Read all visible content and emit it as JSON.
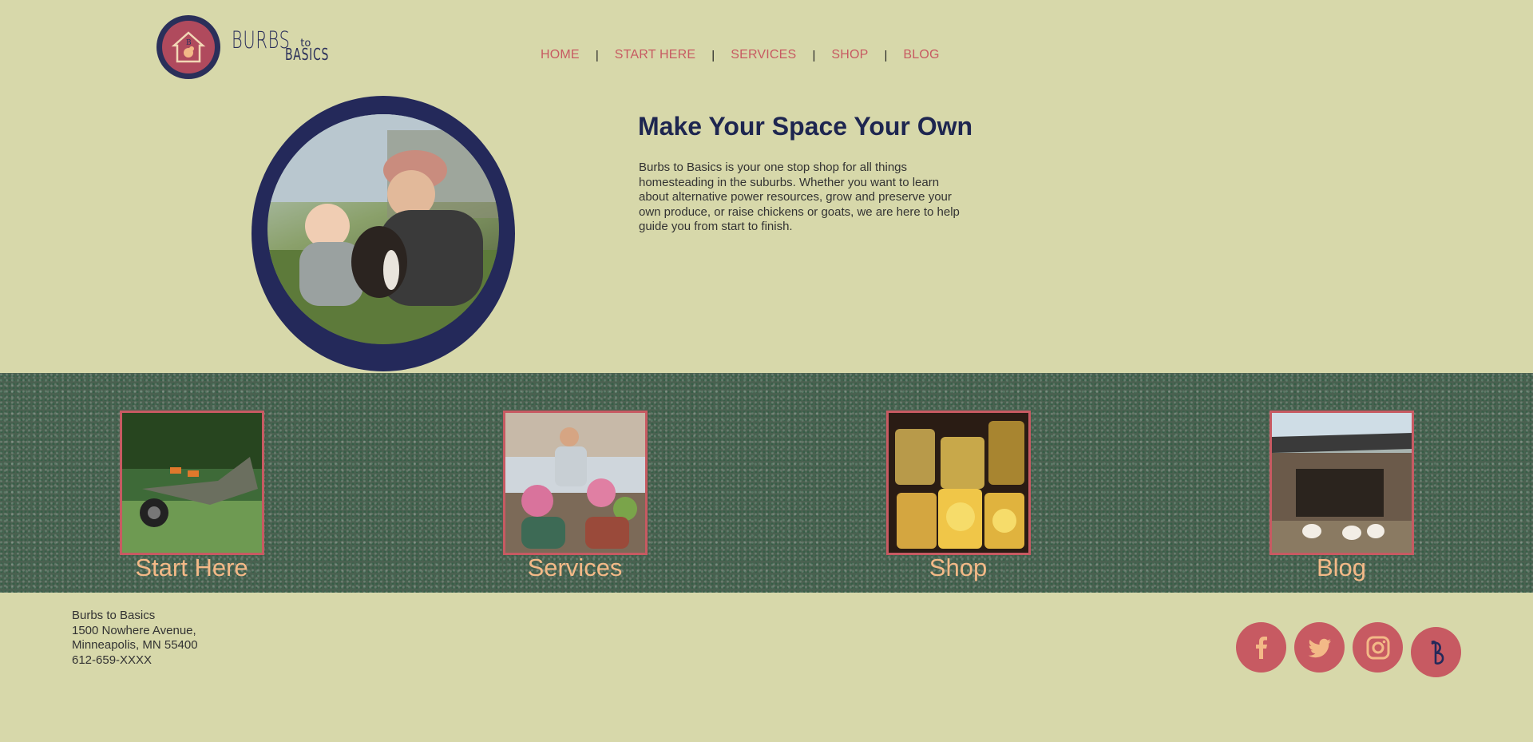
{
  "brand": {
    "name_line1": "BURBS",
    "name_to": "to",
    "name_line2": "BASICS"
  },
  "nav": [
    {
      "label": "HOME"
    },
    {
      "label": "START HERE"
    },
    {
      "label": "SERVICES"
    },
    {
      "label": "SHOP"
    },
    {
      "label": "BLOG"
    }
  ],
  "nav_separator": "|",
  "hero": {
    "title": "Make Your Space Your Own",
    "body": "Burbs to Basics is your one stop shop for all things homesteading in the suburbs. Whether you want to learn about alternative power resources, grow and preserve your own produce, or raise chickens or goats, we are here to help guide you from start to finish."
  },
  "tiles": [
    {
      "label": "Start Here",
      "image": "wheelbarrow-on-lawn"
    },
    {
      "label": "Services",
      "image": "man-potting-flowers"
    },
    {
      "label": "Shop",
      "image": "jars-of-preserved-lemons"
    },
    {
      "label": "Blog",
      "image": "chickens-in-coop"
    }
  ],
  "footer": {
    "address_lines": [
      "Burbs to Basics",
      "1500 Nowhere Avenue,",
      "Minneapolis, MN 55400",
      "612-659-XXXX"
    ],
    "social": [
      "facebook-icon",
      "twitter-icon",
      "instagram-icon",
      "brand-b-icon"
    ]
  },
  "colors": {
    "background": "#d7d8aa",
    "navy": "#24295a",
    "accent": "#c75a62",
    "tile_label": "#f3b987",
    "band": "#4a6150"
  }
}
